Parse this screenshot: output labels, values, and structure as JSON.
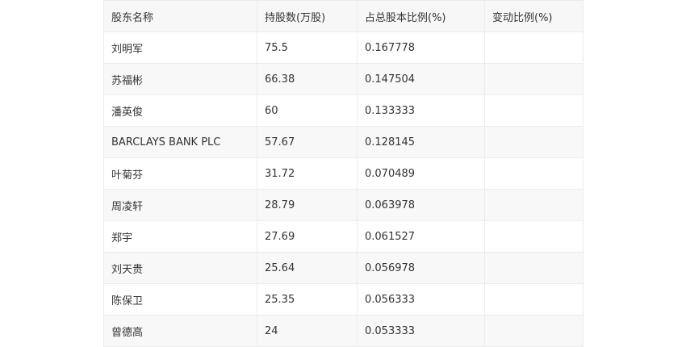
{
  "table": {
    "headers": [
      "股东名称",
      "持股数(万股)",
      "占总股本比例(%)",
      "变动比例(%)"
    ],
    "rows": [
      [
        "刘明军",
        "75.5",
        "0.167778",
        ""
      ],
      [
        "苏福彬",
        "66.38",
        "0.147504",
        ""
      ],
      [
        "潘英俊",
        "60",
        "0.133333",
        ""
      ],
      [
        "BARCLAYS BANK PLC",
        "57.67",
        "0.128145",
        ""
      ],
      [
        "叶菊芬",
        "31.72",
        "0.070489",
        ""
      ],
      [
        "周凌轩",
        "28.79",
        "0.063978",
        ""
      ],
      [
        "郑宇",
        "27.69",
        "0.061527",
        ""
      ],
      [
        "刘天贵",
        "25.64",
        "0.056978",
        ""
      ],
      [
        "陈保卫",
        "25.35",
        "0.056333",
        ""
      ],
      [
        "曾德高",
        "24",
        "0.053333",
        ""
      ]
    ]
  }
}
